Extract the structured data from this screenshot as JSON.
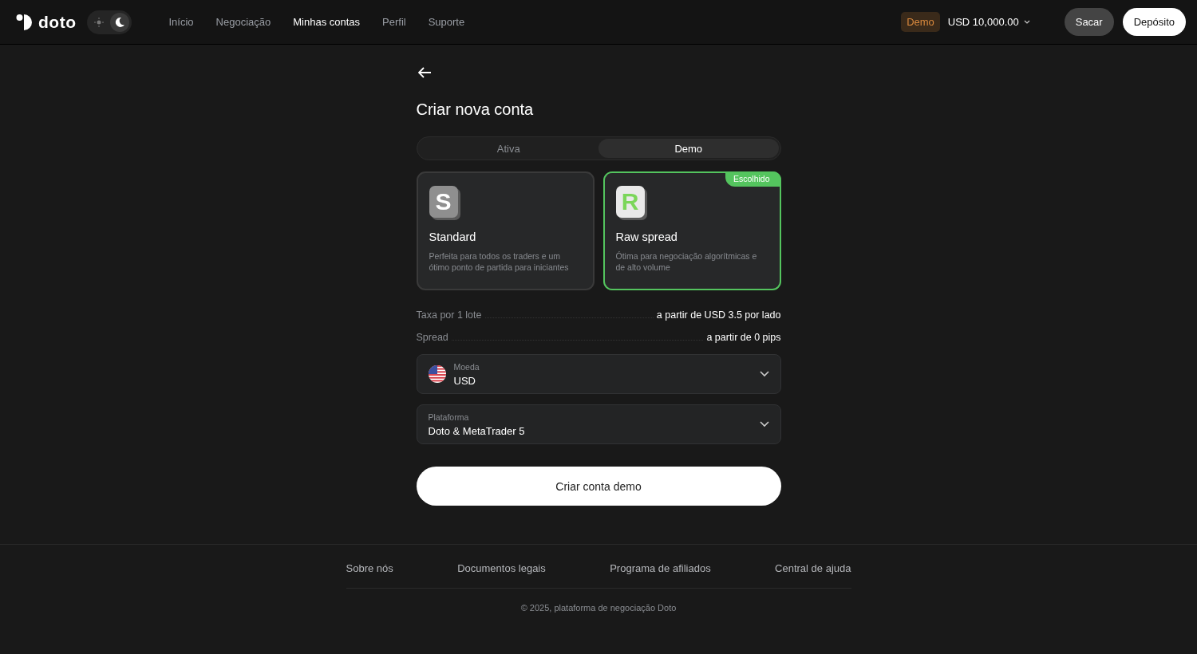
{
  "header": {
    "logo": "doto",
    "theme": [
      {
        "kind": "light",
        "selected": false
      },
      {
        "kind": "dark",
        "selected": true
      }
    ],
    "nav": [
      {
        "label": "Início",
        "selected": false
      },
      {
        "label": "Negociação",
        "selected": false
      },
      {
        "label": "Minhas contas",
        "selected": true
      },
      {
        "label": "Perfil",
        "selected": false
      },
      {
        "label": "Suporte",
        "selected": false
      }
    ],
    "account_badge": "Demo",
    "balance": "USD 10,000.00",
    "buttons": [
      {
        "label": "Sacar",
        "kind": "secondary"
      },
      {
        "label": "Depósito",
        "kind": "primary"
      }
    ]
  },
  "page": {
    "title": "Criar nova conta",
    "tabs": [
      {
        "label": "Ativa",
        "selected": false
      },
      {
        "label": "Demo",
        "selected": true
      }
    ],
    "account_types": [
      {
        "letter": "S",
        "name": "Standard",
        "description": "Perfeita para todos os traders e um ótimo ponto de partida para iniciantes",
        "selected": false
      },
      {
        "letter": "R",
        "name": "Raw spread",
        "description": "Ótima para negociação algorítmicas e de alto volume",
        "selected": true,
        "badge": "Escolhido"
      }
    ],
    "details": [
      {
        "label": "Taxa por 1 lote",
        "value": "a partir de USD 3.5 por lado"
      },
      {
        "label": "Spread",
        "value": "a partir de 0 pips"
      }
    ],
    "selects": [
      {
        "kind": "currency",
        "label": "Moeda",
        "value": "USD"
      },
      {
        "kind": "plain",
        "label": "Plataforma",
        "value": "Doto & MetaTrader 5"
      }
    ],
    "submit": "Criar conta demo"
  },
  "footer": {
    "links": [
      "Sobre nós",
      "Documentos legais",
      "Programa de afiliados",
      "Central de ajuda"
    ],
    "copyright": "© 2025, plataforma de negociação Doto"
  }
}
